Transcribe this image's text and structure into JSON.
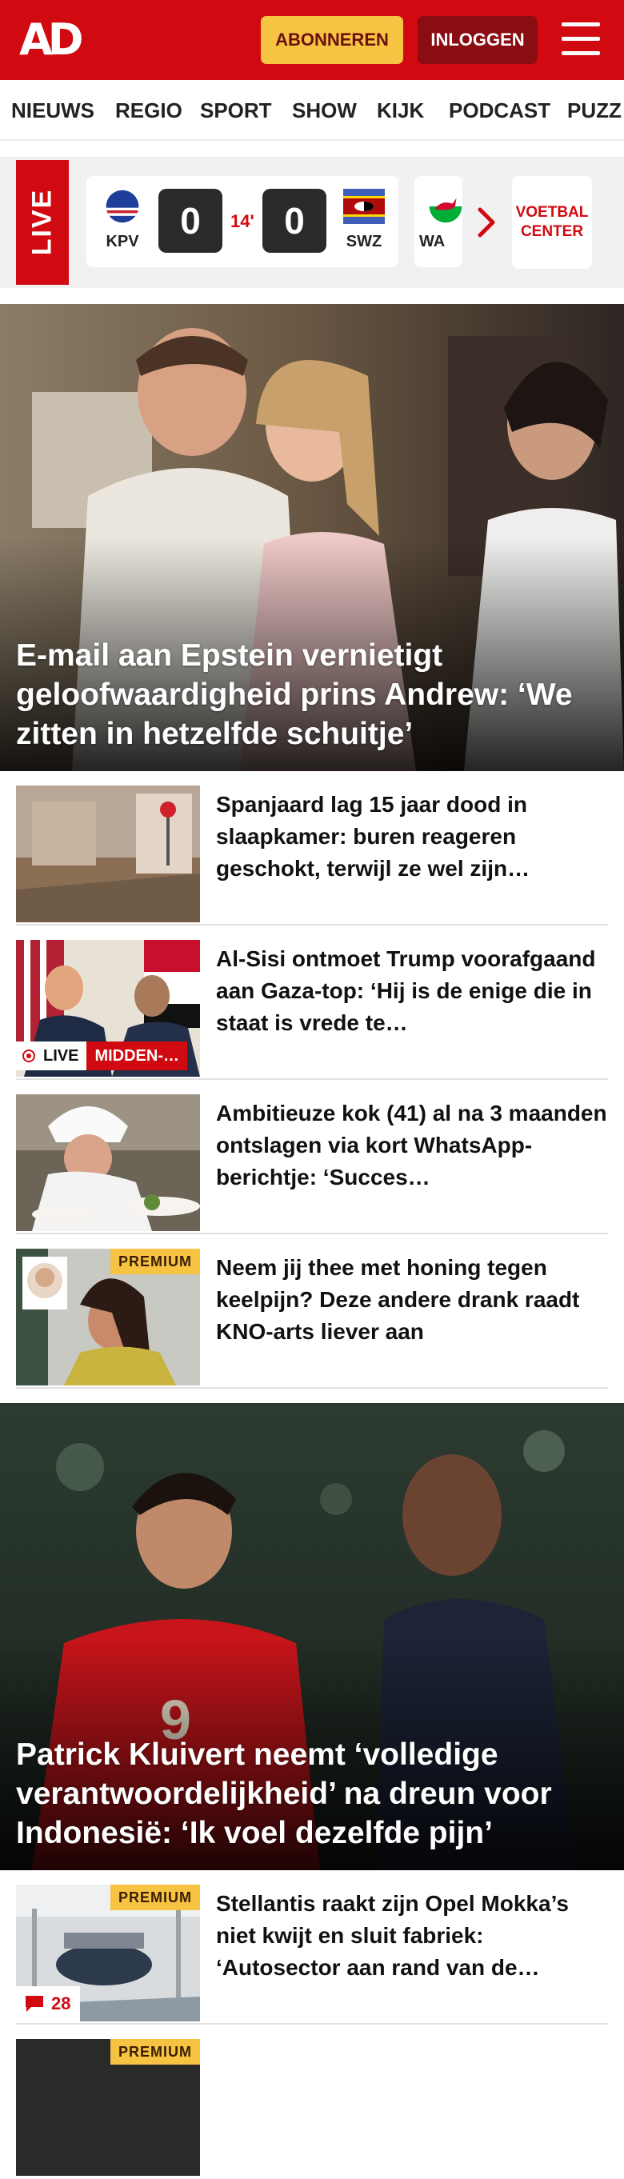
{
  "header": {
    "logo": "AD",
    "subscribe_label": "ABONNEREN",
    "login_label": "INLOGGEN",
    "menu_icon": "hamburger-menu-icon",
    "brand_color": "#d10a11",
    "subscribe_color": "#f6c343"
  },
  "nav": {
    "items": [
      "NIEUWS",
      "REGIO",
      "SPORT",
      "SHOW",
      "KIJK",
      "PODCAST",
      "PUZZ"
    ]
  },
  "live_scores": {
    "live_label": "LIVE",
    "match": {
      "home_code": "KPV",
      "home_score": "0",
      "minute": "14'",
      "away_score": "0",
      "away_code": "SWZ"
    },
    "next_match_code": "WA",
    "more_label_1": "VOETBAL",
    "more_label_2": "CENTER"
  },
  "articles": [
    {
      "title": "E-mail aan Epstein vernietigt geloofwaardigheid prins Andrew: ‘We zitten in hetzelfde schuitje’"
    },
    {
      "title": "Spanjaard lag 15 jaar dood in slaapkamer: buren reageren geschokt, terwijl ze wel zijn…"
    },
    {
      "title": "Al-Sisi ontmoet Trump vooraf­gaand aan Gaza-top: ‘Hij is de enige die in staat is vrede te…",
      "live_label": "LIVE",
      "tag_label": "MIDDEN-…"
    },
    {
      "title": "Ambitieuze kok (41) al na 3 maanden ontslagen via kort WhatsApp-berichtje: ‘Succes…"
    },
    {
      "title": "Neem jij thee met honing tegen keelpijn? Deze andere drank raadt KNO-arts liever aan",
      "premium_label": "PREMIUM"
    },
    {
      "title": "Patrick Kluivert neemt ‘volledige verantwoordelijkheid’ na dreun voor Indonesië: ‘Ik voel dezelfde pijn’"
    },
    {
      "title": "Stellantis raakt zijn Opel Mokka’s niet kwijt en sluit fabriek: ‘Autosector aan rand van de…",
      "premium_label": "PREMIUM",
      "comment_count": "28"
    },
    {
      "premium_label": "PREMIUM"
    }
  ]
}
